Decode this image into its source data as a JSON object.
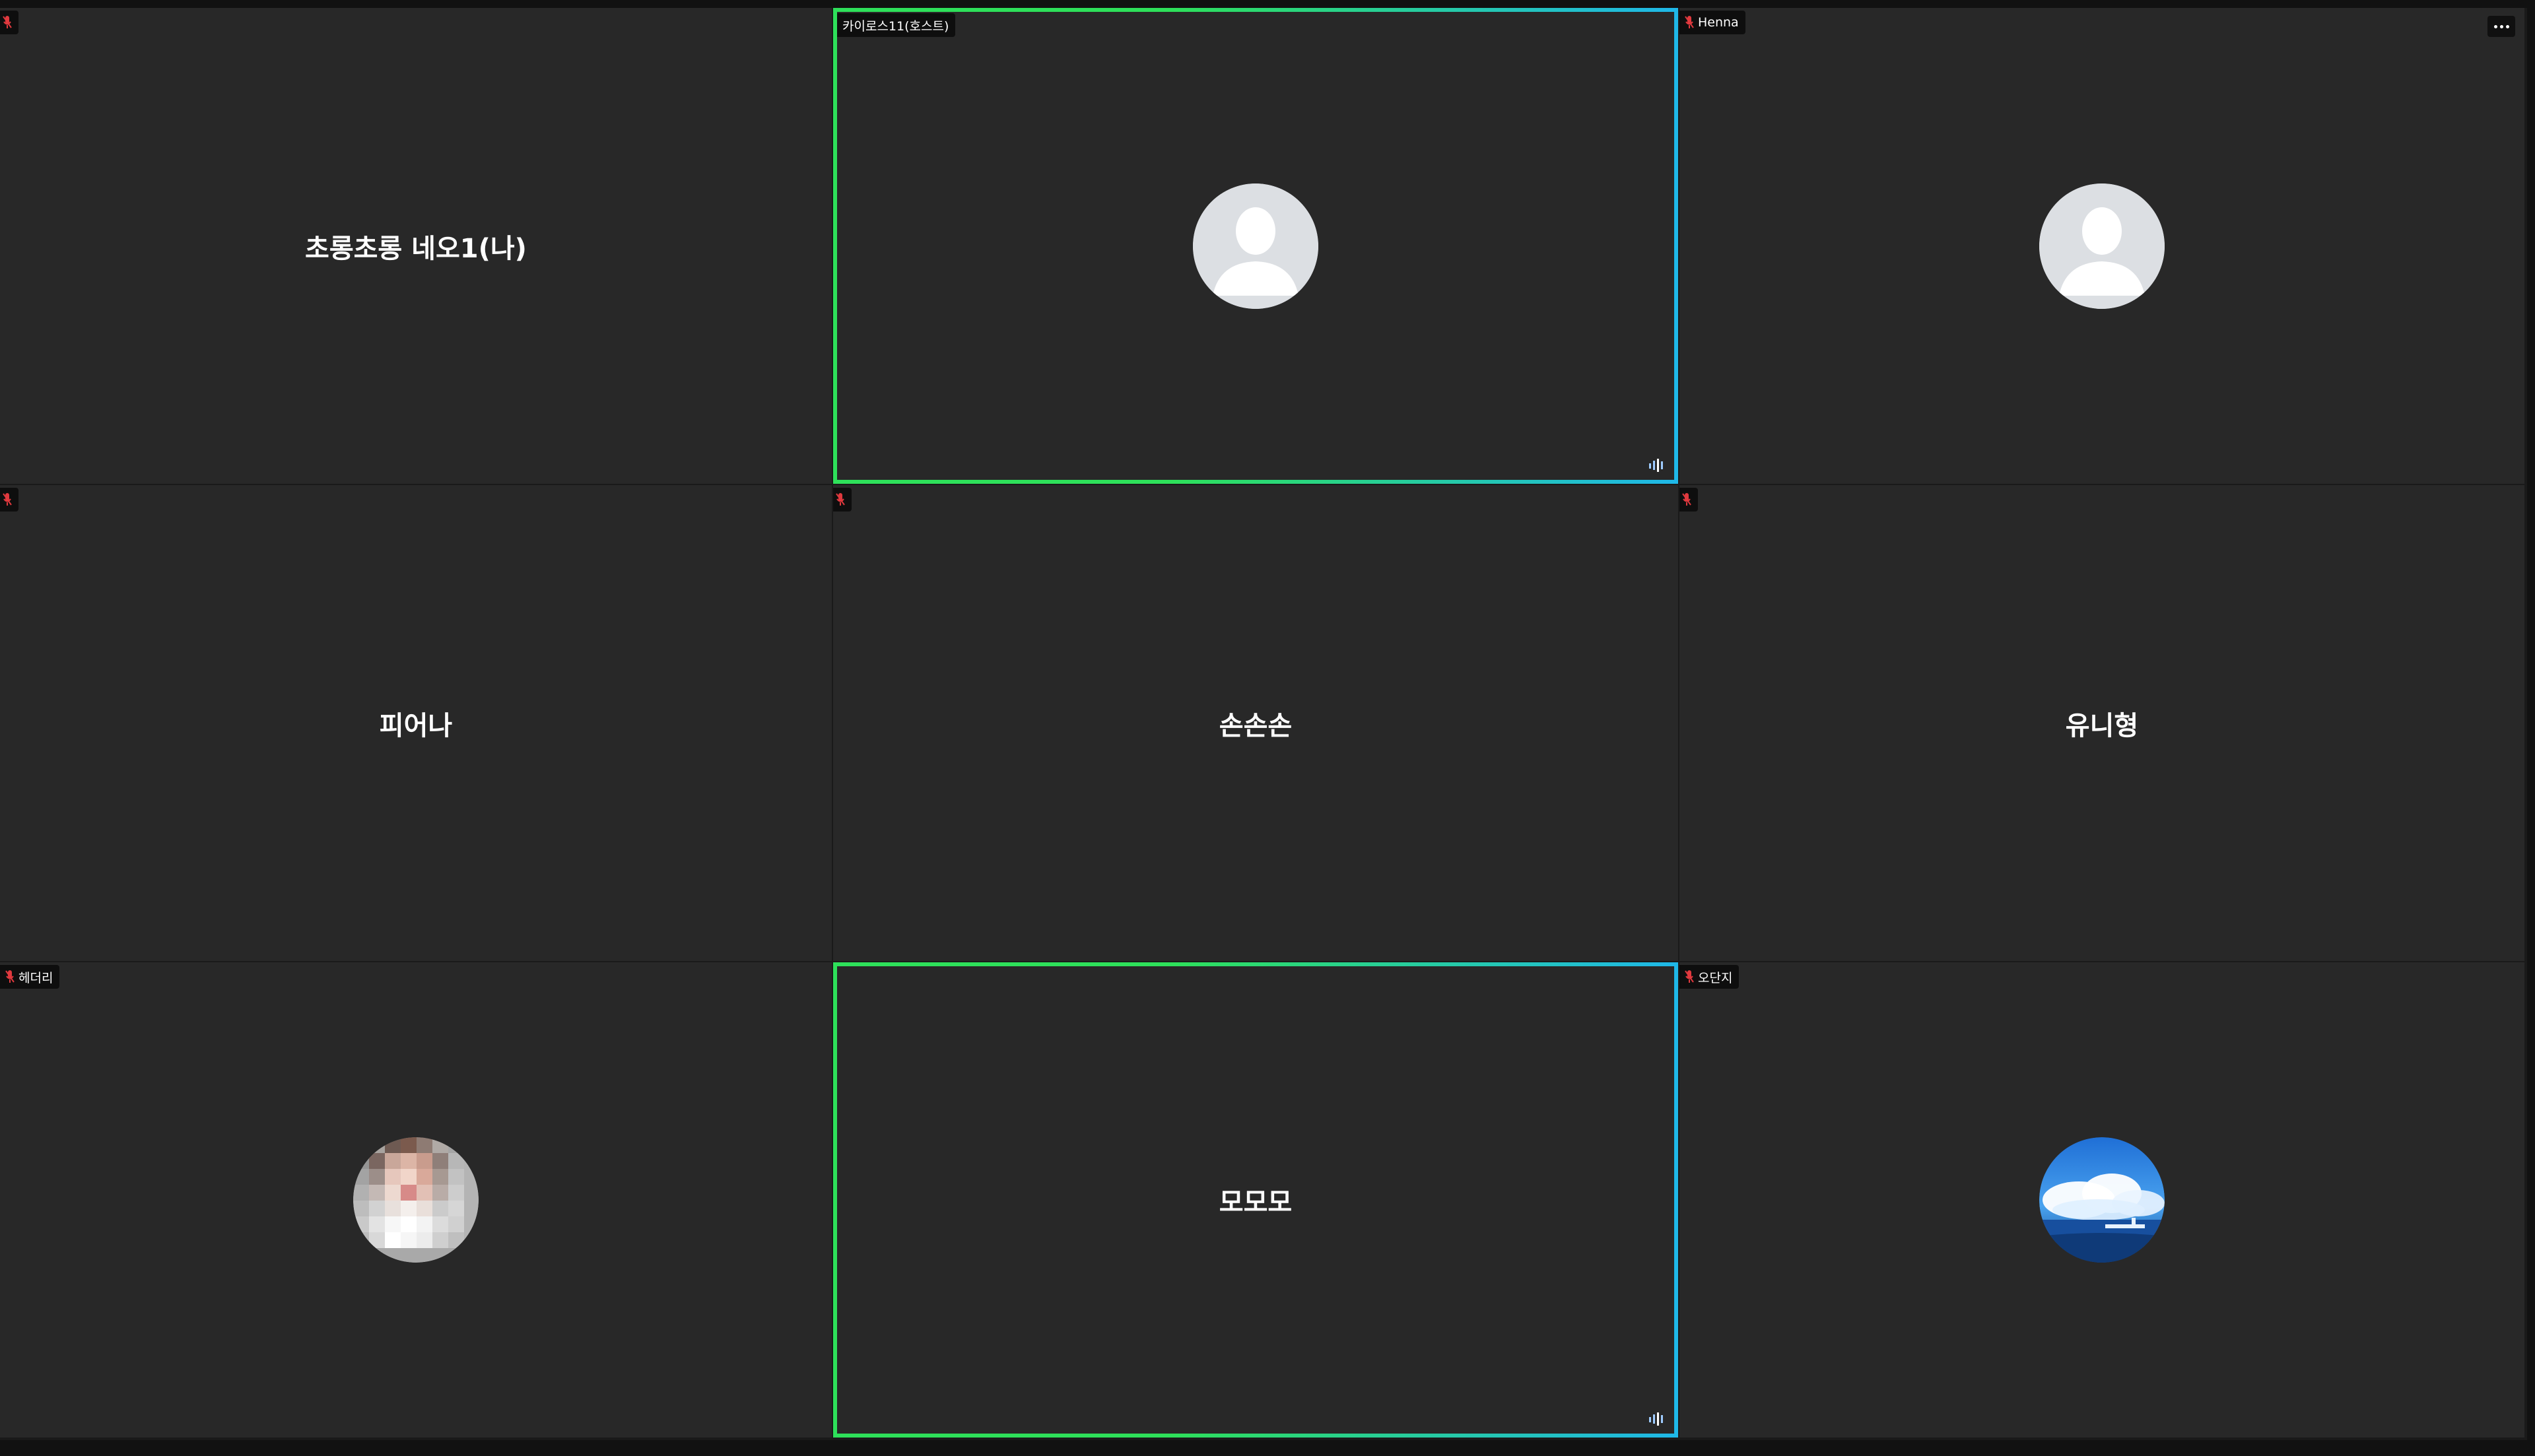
{
  "participants": [
    {
      "name_tag": "",
      "center_name": "초롱초롱 네오1(나)",
      "muted": true,
      "speaking": false,
      "avatar": "none"
    },
    {
      "name_tag": "카이로스11(호스트)",
      "center_name": "",
      "muted": false,
      "speaking": true,
      "avatar": "default-person-icon"
    },
    {
      "name_tag": "Henna",
      "center_name": "",
      "muted": true,
      "speaking": false,
      "avatar": "default-person-icon"
    },
    {
      "name_tag": "",
      "center_name": "피어나",
      "muted": true,
      "speaking": false,
      "avatar": "none"
    },
    {
      "name_tag": "",
      "center_name": "손손손",
      "muted": true,
      "speaking": false,
      "avatar": "none"
    },
    {
      "name_tag": "",
      "center_name": "유니형",
      "muted": true,
      "speaking": false,
      "avatar": "none"
    },
    {
      "name_tag": "헤더리",
      "center_name": "",
      "muted": true,
      "speaking": false,
      "avatar": "pixelated-photo"
    },
    {
      "name_tag": "",
      "center_name": "모모모",
      "muted": false,
      "speaking": true,
      "avatar": "none"
    },
    {
      "name_tag": "오단지",
      "center_name": "",
      "muted": true,
      "speaking": false,
      "avatar": "landscape-photo"
    }
  ],
  "colors": {
    "tile_background": "#282828",
    "speaking_border_start": "#2ee05a",
    "speaking_border_end": "#1fb8e8",
    "mute_icon": "#e0393e"
  }
}
